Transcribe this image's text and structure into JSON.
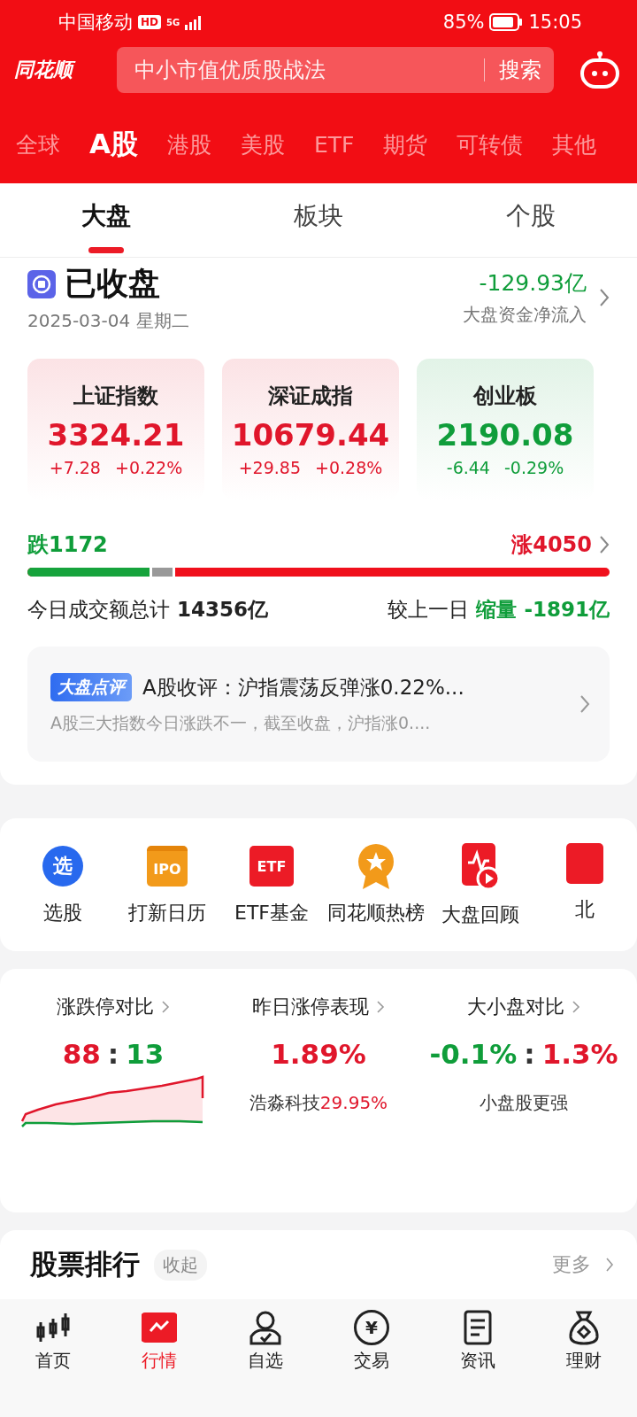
{
  "status_bar": {
    "carrier": "中国移动",
    "hd": "HD",
    "network": "5G",
    "battery": "85%",
    "time": "15:05"
  },
  "header": {
    "logo": "同花顺",
    "search": {
      "placeholder": "中小市值优质股战法",
      "button": "搜索"
    }
  },
  "market_tabs": [
    {
      "label": "全球",
      "selected": false
    },
    {
      "label": "A股",
      "selected": true
    },
    {
      "label": "港股",
      "selected": false
    },
    {
      "label": "美股",
      "selected": false
    },
    {
      "label": "ETF",
      "selected": false
    },
    {
      "label": "期货",
      "selected": false
    },
    {
      "label": "可转债",
      "selected": false
    },
    {
      "label": "其他",
      "selected": false
    }
  ],
  "sub_tabs": [
    {
      "label": "大盘",
      "selected": true
    },
    {
      "label": "板块",
      "selected": false
    },
    {
      "label": "个股",
      "selected": false
    }
  ],
  "market_status": {
    "title": "已收盘",
    "date": "2025-03-04 星期二",
    "net_inflow": "-129.93亿",
    "net_inflow_label": "大盘资金净流入"
  },
  "indices": [
    {
      "name": "上证指数",
      "value": "3324.21",
      "change": "+7.28",
      "percent": "+0.22%",
      "color": "#e0162b"
    },
    {
      "name": "深证成指",
      "value": "10679.44",
      "change": "+29.85",
      "percent": "+0.28%",
      "color": "#e0162b"
    },
    {
      "name": "创业板",
      "value": "2190.08",
      "change": "-6.44",
      "percent": "-0.29%",
      "color": "#0f9d3a"
    }
  ],
  "breadth": {
    "down": "跌1172",
    "up": "涨4050",
    "level": 0.215
  },
  "turnover": {
    "label": "今日成交额总计",
    "value": "14356亿",
    "compare_label": "较上一日",
    "compare_tag": "缩量",
    "compare_value": "-1891亿"
  },
  "commentary": {
    "badge": "大盘点评",
    "title": "A股收评：沪指震荡反弹涨0.22%...",
    "summary": "A股三大指数今日涨跌不一，截至收盘，沪指涨0...."
  },
  "shortcuts": [
    {
      "kind": "pick",
      "icon_text": "选",
      "label": "选股"
    },
    {
      "kind": "ipo",
      "icon_text": "IPO",
      "label": "打新日历"
    },
    {
      "kind": "etf",
      "icon_text": "ETF",
      "label": "ETF基金"
    },
    {
      "kind": "hot",
      "label": "同花顺热榜"
    },
    {
      "kind": "review",
      "label": "大盘回顾"
    },
    {
      "kind": "north",
      "label": "北"
    }
  ],
  "stats": [
    {
      "kind": "limit",
      "title": "涨跌停对比",
      "parts": [
        {
          "text": "88",
          "color": "#e0162b"
        },
        {
          "text": ":",
          "color": "#333333"
        },
        {
          "text": "13",
          "color": "#0f9d3a"
        }
      ]
    },
    {
      "kind": "performance",
      "title": "昨日涨停表现",
      "parts": [
        {
          "text": "1.89%",
          "color": "#e0162b"
        }
      ],
      "note": "浩淼科技",
      "note_value": "29.95%"
    },
    {
      "kind": "size",
      "title": "大小盘对比",
      "parts": [
        {
          "text": "-0.1%",
          "color": "#0f9d3a"
        },
        {
          "text": ":",
          "color": "#333333"
        },
        {
          "text": "1.3%",
          "color": "#e0162b"
        }
      ],
      "caption": "小盘股更强"
    }
  ],
  "ranking": {
    "title": "股票排行",
    "collapse": "收起",
    "more": "更多"
  },
  "bottom_nav": [
    {
      "kind": "home",
      "label": "首页",
      "selected": false
    },
    {
      "kind": "market",
      "label": "行情",
      "selected": true
    },
    {
      "kind": "watch",
      "label": "自选",
      "selected": false
    },
    {
      "kind": "trade",
      "label": "交易",
      "icon_text": "¥",
      "selected": false
    },
    {
      "kind": "news",
      "label": "资讯",
      "selected": false
    },
    {
      "kind": "wealth",
      "label": "理财",
      "selected": false
    }
  ]
}
